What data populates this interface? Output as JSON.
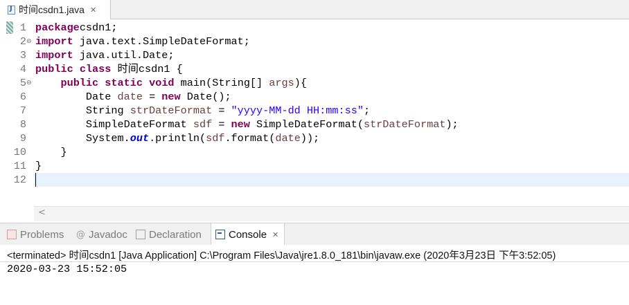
{
  "editor_tab": {
    "title": "时间csdn1.java",
    "close": "✕"
  },
  "code_lines": [
    {
      "n": "1",
      "fold": "",
      "parts": [
        [
          "kw",
          "package"
        ],
        [
          "",
          "csdn1;"
        ]
      ]
    },
    {
      "n": "2",
      "fold": "⊖",
      "parts": [
        [
          "kw",
          "import"
        ],
        [
          "",
          " java.text.SimpleDateFormat;"
        ]
      ]
    },
    {
      "n": "3",
      "fold": "",
      "parts": [
        [
          "kw",
          "import"
        ],
        [
          "",
          " java.util.Date;"
        ]
      ]
    },
    {
      "n": "4",
      "fold": "",
      "parts": [
        [
          "kw",
          "public"
        ],
        [
          "",
          " "
        ],
        [
          "kw",
          "class"
        ],
        [
          "",
          " 时间csdn1 {"
        ]
      ]
    },
    {
      "n": "5",
      "fold": "⊖",
      "parts": [
        [
          "",
          "    "
        ],
        [
          "kw",
          "public"
        ],
        [
          "",
          " "
        ],
        [
          "kw",
          "static"
        ],
        [
          "",
          " "
        ],
        [
          "kw",
          "void"
        ],
        [
          "",
          " main(String[] "
        ],
        [
          "var",
          "args"
        ],
        [
          "",
          "){"
        ]
      ]
    },
    {
      "n": "6",
      "fold": "",
      "parts": [
        [
          "",
          "        Date "
        ],
        [
          "var",
          "date"
        ],
        [
          "",
          " = "
        ],
        [
          "kw",
          "new"
        ],
        [
          "",
          " Date();"
        ]
      ]
    },
    {
      "n": "7",
      "fold": "",
      "parts": [
        [
          "",
          "        String "
        ],
        [
          "var",
          "strDateFormat"
        ],
        [
          "",
          " = "
        ],
        [
          "str",
          "\"yyyy-MM-dd HH:mm:ss\""
        ],
        [
          "",
          ";"
        ]
      ]
    },
    {
      "n": "8",
      "fold": "",
      "parts": [
        [
          "",
          "        SimpleDateFormat "
        ],
        [
          "var",
          "sdf"
        ],
        [
          "",
          " = "
        ],
        [
          "kw",
          "new"
        ],
        [
          "",
          " SimpleDateFormat("
        ],
        [
          "var",
          "strDateFormat"
        ],
        [
          "",
          ");"
        ]
      ]
    },
    {
      "n": "9",
      "fold": "",
      "parts": [
        [
          "",
          "        System."
        ],
        [
          "fld",
          "out"
        ],
        [
          "",
          ".println("
        ],
        [
          "var",
          "sdf"
        ],
        [
          "",
          ".format("
        ],
        [
          "var",
          "date"
        ],
        [
          "",
          "));"
        ]
      ]
    },
    {
      "n": "10",
      "fold": "",
      "parts": [
        [
          "",
          "    }"
        ]
      ]
    },
    {
      "n": "11",
      "fold": "",
      "parts": [
        [
          "",
          "}"
        ]
      ]
    },
    {
      "n": "12",
      "fold": "",
      "parts": []
    }
  ],
  "scroll_left": "<",
  "panel_tabs": {
    "problems": "Problems",
    "javadoc_icon": "@",
    "javadoc": "Javadoc",
    "declaration": "Declaration",
    "console": "Console",
    "console_close": "✕"
  },
  "console": {
    "status": "<terminated> 时间csdn1 [Java Application] C:\\Program Files\\Java\\jre1.8.0_181\\bin\\javaw.exe (2020年3月23日 下午3:52:05)",
    "output": "2020-03-23 15:52:05"
  },
  "icons": {
    "editor_tab": "java-file-icon",
    "problems": "problems-icon",
    "javadoc": "javadoc-icon",
    "declaration": "declaration-icon",
    "console": "console-icon"
  }
}
